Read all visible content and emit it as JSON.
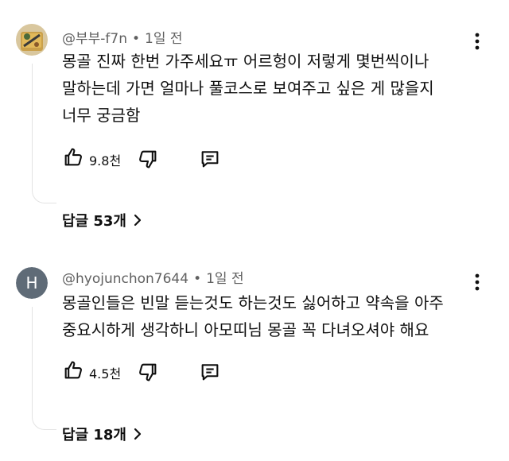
{
  "comments": [
    {
      "author": "@부부-f7n",
      "time": "1일 전",
      "lines": [
        "몽골 진짜 한번 가주세요ㅠ 어르헝이 저렇게 몇번씩이나",
        "말하는데 가면 얼마나 풀코스로 보여주고 싶은 게 많을지",
        "너무 궁금함"
      ],
      "likes": "9.8천",
      "replies": "답글 53개",
      "avatar_icon": "photo-avatar"
    },
    {
      "author": "@hyojunchon7644",
      "time": "1일 전",
      "lines": [
        "몽골인들은 빈말 듣는것도 하는것도 싫어하고 약속을 아주",
        "중요시하게 생각하니 아모띠님 몽골 꼭 다녀오셔야 해요"
      ],
      "likes": "4.5천",
      "replies": "답글 18개",
      "avatar_letter": "H",
      "avatar_color": "#5f6b77"
    }
  ],
  "separator": "•"
}
